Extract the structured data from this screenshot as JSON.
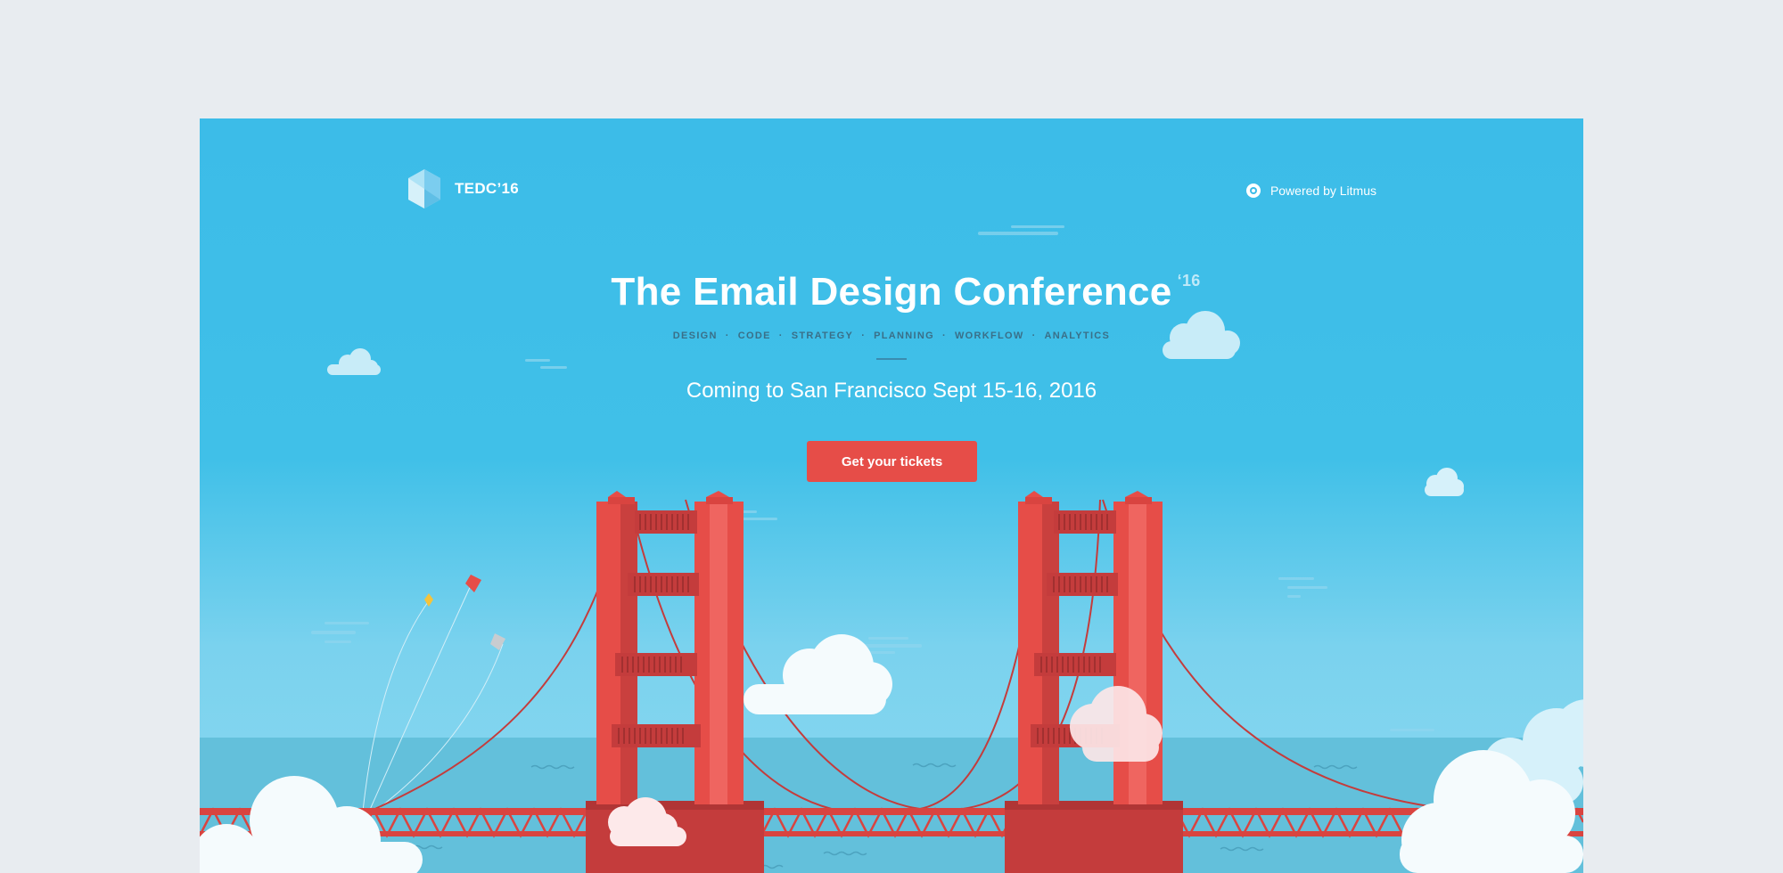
{
  "header": {
    "logo_text": "TEDC’16",
    "logo_icon": "hexagon-gem-icon",
    "powered_text": "Powered by Litmus",
    "powered_icon": "litmus-gear-icon"
  },
  "hero": {
    "title": "The Email Design Conference",
    "title_sup": "‘16",
    "topics": [
      "DESIGN",
      "CODE",
      "STRATEGY",
      "PLANNING",
      "WORKFLOW",
      "ANALYTICS"
    ],
    "topic_separator": "·",
    "subtitle": "Coming to San Francisco Sept 15-16, 2016",
    "cta_label": "Get your tickets"
  },
  "colors": {
    "sky": "#3cbce8",
    "water": "#63c0db",
    "bridge": "#e64d48",
    "cta": "#e64d48",
    "cloud": "#f5fbfd",
    "page_bg": "#e8ecf0"
  },
  "illustration": {
    "subject": "golden-gate-bridge-icon"
  }
}
